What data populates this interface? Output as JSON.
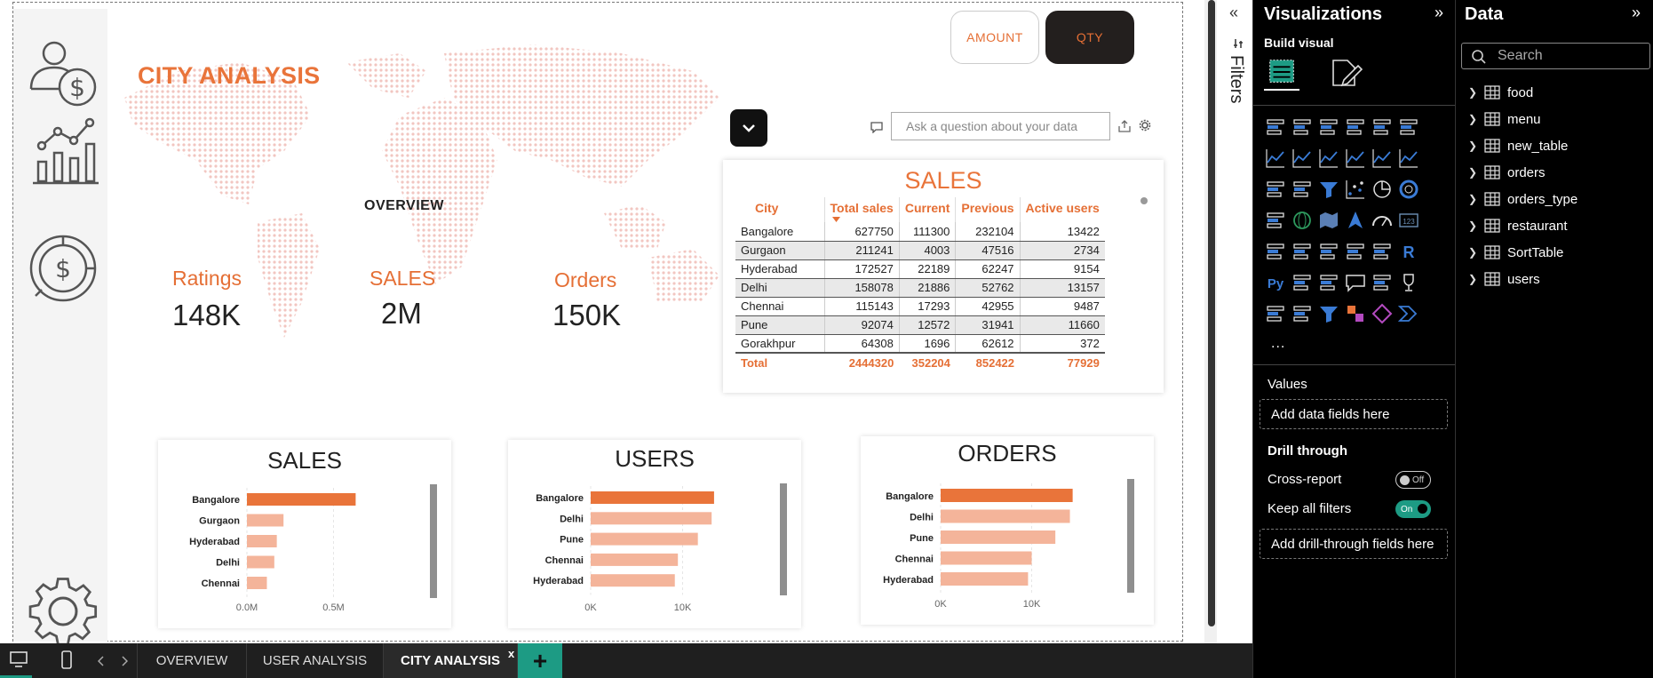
{
  "report": {
    "title": "CITY ANALYSIS",
    "overview_label": "OVERVIEW",
    "toggle": {
      "amount": "AMOUNT",
      "qty": "QTY",
      "selected": "QTY"
    },
    "kpis": [
      {
        "label": "Ratings",
        "value": "148K"
      },
      {
        "label": "SALES",
        "value": "2M"
      },
      {
        "label": "Orders",
        "value": "150K"
      }
    ],
    "qa_placeholder": "Ask a question about your data",
    "sales_table": {
      "title": "SALES",
      "columns": [
        "City",
        "Total sales",
        "Current",
        "Previous",
        "Active users"
      ],
      "rows": [
        [
          "Bangalore",
          "627750",
          "111300",
          "232104",
          "13422"
        ],
        [
          "Gurgaon",
          "211241",
          "4003",
          "47516",
          "2734"
        ],
        [
          "Hyderabad",
          "172527",
          "22189",
          "62247",
          "9154"
        ],
        [
          "Delhi",
          "158078",
          "21886",
          "52762",
          "13157"
        ],
        [
          "Chennai",
          "115143",
          "17293",
          "42955",
          "9487"
        ],
        [
          "Pune",
          "92074",
          "12572",
          "31941",
          "11660"
        ],
        [
          "Gorakhpur",
          "64308",
          "1696",
          "62612",
          "372"
        ]
      ],
      "total": [
        "Total",
        "2444320",
        "352204",
        "852422",
        "77929"
      ]
    },
    "charts": [
      {
        "type": "bar",
        "title": "SALES",
        "categories": [
          "Bangalore",
          "Gurgaon",
          "Hyderabad",
          "Delhi",
          "Chennai"
        ],
        "values": [
          627750,
          211241,
          172527,
          158078,
          115143
        ],
        "xlim": [
          0,
          1000000
        ],
        "ticks": [
          {
            "v": 0,
            "label": "0.0M"
          },
          {
            "v": 500000,
            "label": "0.5M"
          }
        ],
        "highlight_color": "#e9743a",
        "bar_color": "#f4b49a"
      },
      {
        "type": "bar",
        "title": "USERS",
        "categories": [
          "Bangalore",
          "Delhi",
          "Pune",
          "Chennai",
          "Hyderabad"
        ],
        "values": [
          13422,
          13157,
          11660,
          9487,
          9154
        ],
        "xlim": [
          0,
          20000
        ],
        "ticks": [
          {
            "v": 0,
            "label": "0K"
          },
          {
            "v": 10000,
            "label": "10K"
          }
        ],
        "highlight_color": "#e9743a",
        "bar_color": "#f4b49a"
      },
      {
        "type": "bar",
        "title": "ORDERS",
        "categories": [
          "Bangalore",
          "Delhi",
          "Pune",
          "Chennai",
          "Hyderabad"
        ],
        "values": [
          14500,
          14200,
          12600,
          10000,
          9600
        ],
        "xlim": [
          0,
          20000
        ],
        "ticks": [
          {
            "v": 0,
            "label": "0K"
          },
          {
            "v": 10000,
            "label": "10K"
          }
        ],
        "highlight_color": "#e9743a",
        "bar_color": "#f4b49a"
      }
    ]
  },
  "pagebar": {
    "tabs": [
      "OVERVIEW",
      "USER ANALYSIS",
      "CITY ANALYSIS"
    ],
    "active": "CITY ANALYSIS",
    "close_label": "x",
    "add_label": "+"
  },
  "filters": {
    "label": "Filters",
    "collapse_glyph": "«"
  },
  "visualizations": {
    "title": "Visualizations",
    "expand_glyph": "»",
    "build_visual": "Build visual",
    "more": "...",
    "values_label": "Values",
    "values_drop": "Add data fields here",
    "drill_through": "Drill through",
    "cross_report": "Cross-report",
    "cross_report_state": "Off",
    "keep_filters": "Keep all filters",
    "keep_filters_state": "On",
    "drill_drop": "Add drill-through fields here",
    "icon_r": "R",
    "icon_py": "Py",
    "icon_123": "123"
  },
  "data_pane": {
    "title": "Data",
    "expand_glyph": "»",
    "search_placeholder": "Search",
    "tables": [
      "food",
      "menu",
      "new_table",
      "orders",
      "orders_type",
      "restaurant",
      "SortTable",
      "users"
    ]
  },
  "colors": {
    "accent": "#e9743a",
    "teal": "#1d9b84",
    "dark": "#231f1e"
  }
}
